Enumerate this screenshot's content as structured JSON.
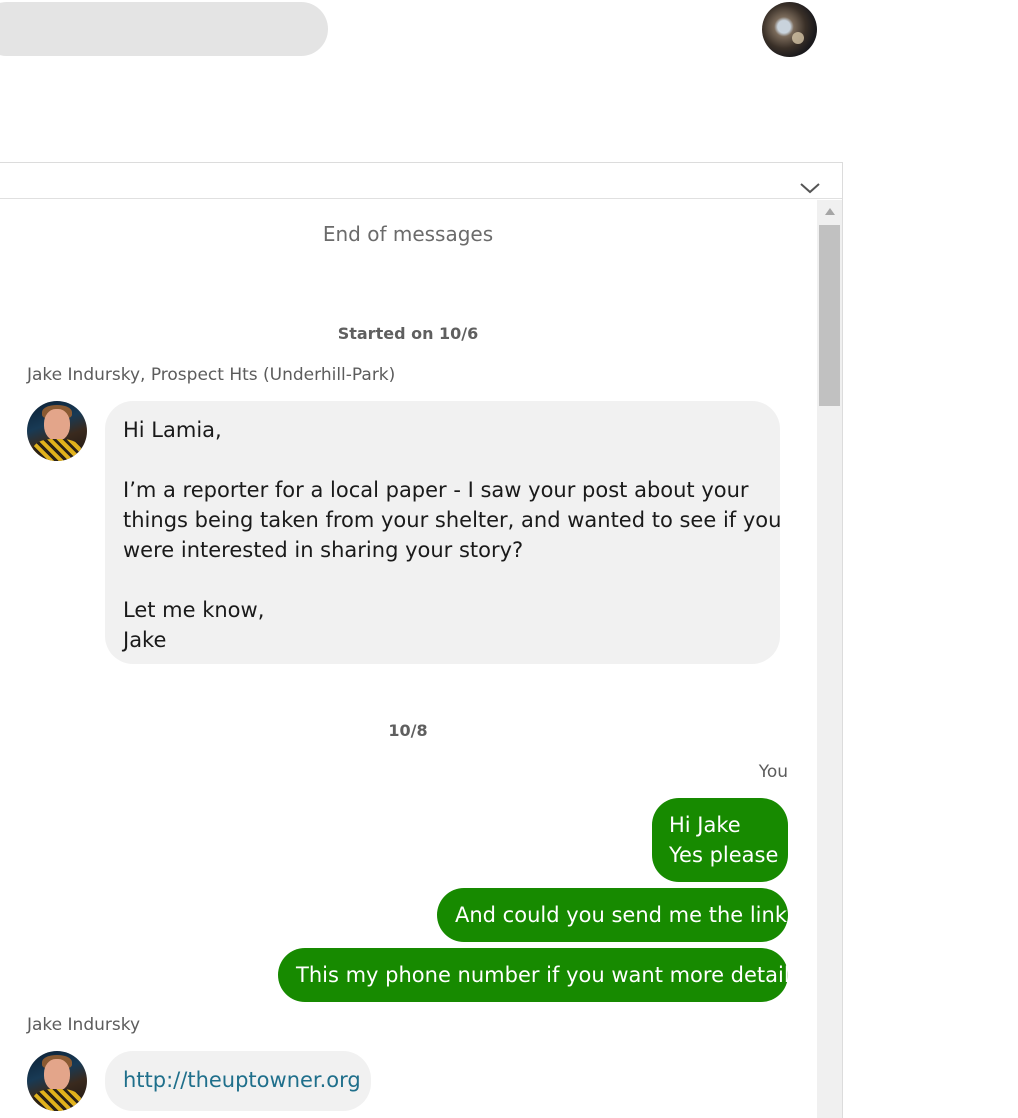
{
  "top_bar": {
    "search_icon": "search-pill",
    "profile_avatar_icon": "user-avatar-icon"
  },
  "panel": {
    "collapse_icon": "chevron-down-icon"
  },
  "conversation": {
    "end_of_messages": "End of messages",
    "started_label": "Started on 10/6",
    "first_sender": "Jake Indursky, Prospect Hts (Underhill-Park)",
    "first_message": {
      "line1": "Hi Lamia,",
      "line2": "I’m a reporter for a local paper - I saw your post about your",
      "line3": "things being taken from your shelter, and wanted to see if you",
      "line4": "were interested in sharing your story?",
      "line5": "Let me know,",
      "line6": "Jake"
    },
    "second_date": "10/8",
    "you_label": "You",
    "outgoing": {
      "msg1_line1": "Hi Jake",
      "msg1_line2": "Yes please",
      "msg2": "And could you send me the link",
      "msg3": "This my phone number if you want more details"
    },
    "second_sender": "Jake Indursky",
    "link_message": "http://theuptowner.org"
  },
  "colors": {
    "outgoing_bubble": "#178a00",
    "incoming_bubble": "#f1f1f1",
    "link": "#1f6f8b"
  }
}
